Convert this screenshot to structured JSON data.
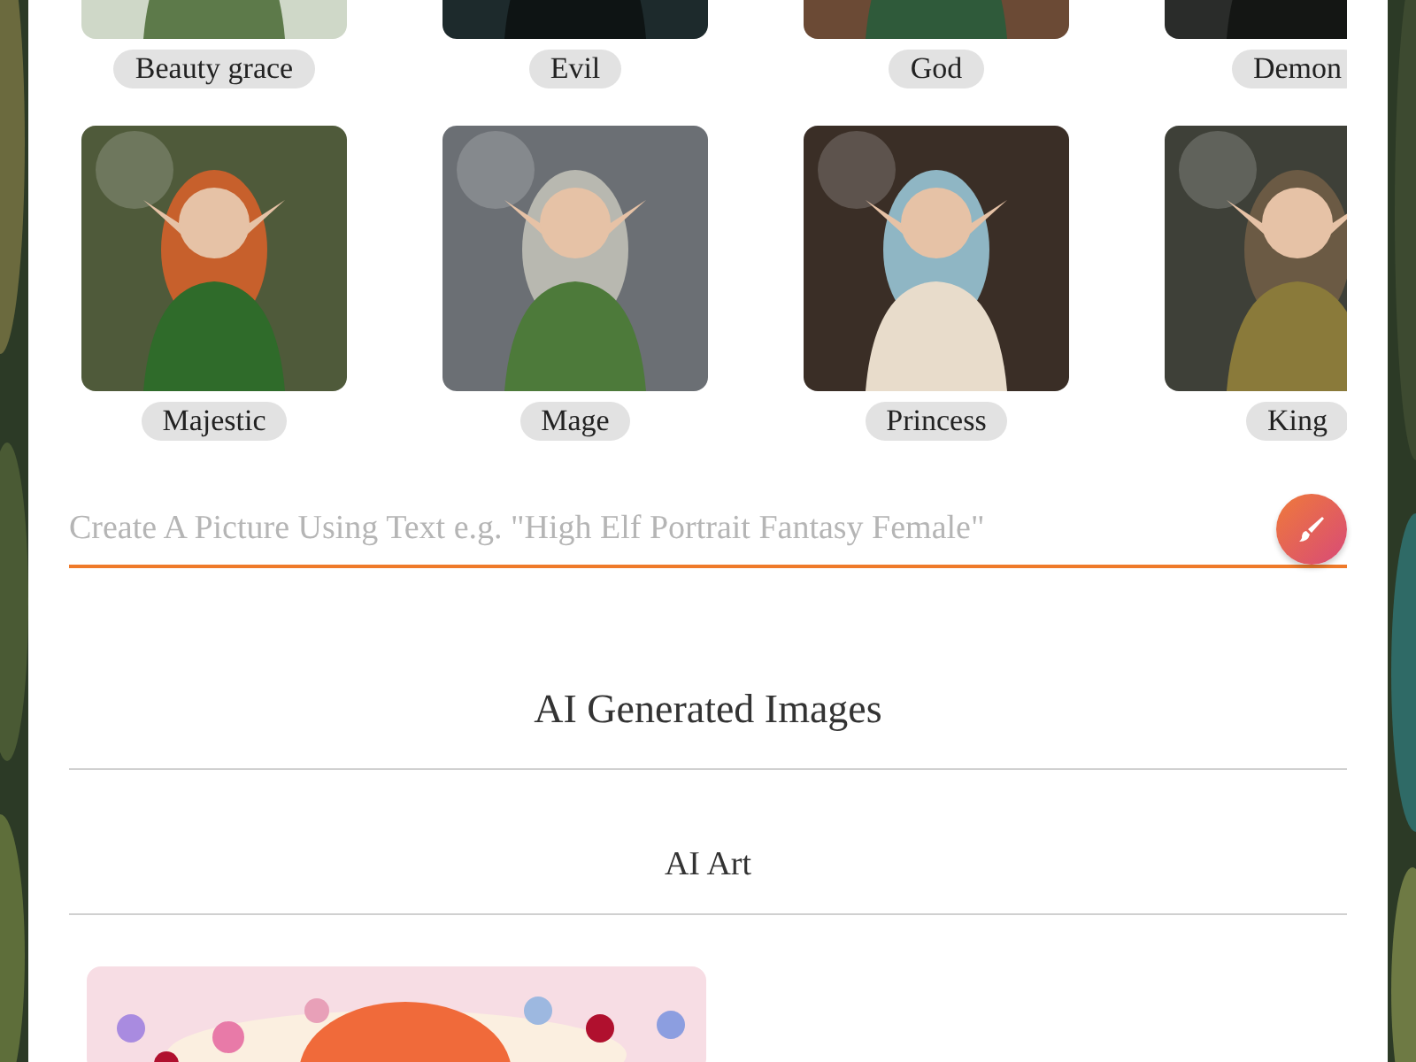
{
  "styles": [
    {
      "label": "Beauty grace"
    },
    {
      "label": "Evil"
    },
    {
      "label": "God"
    },
    {
      "label": "Demon"
    },
    {
      "label": "Majestic"
    },
    {
      "label": "Mage"
    },
    {
      "label": "Princess"
    },
    {
      "label": "King"
    }
  ],
  "prompt": {
    "placeholder": "Create A Picture Using Text e.g. \"High Elf Portrait Fantasy Female\""
  },
  "heading": "AI Generated Images",
  "subheading": "AI Art"
}
